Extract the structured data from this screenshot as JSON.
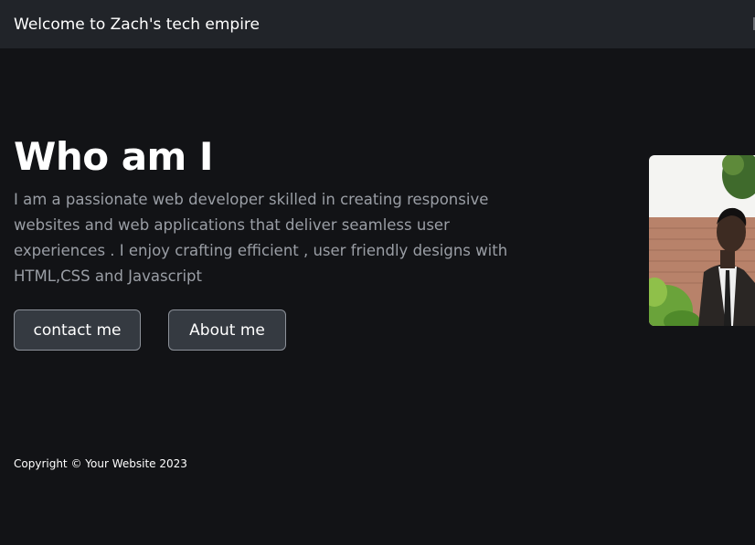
{
  "navbar": {
    "brand": "Welcome to Zach's tech empire"
  },
  "hero": {
    "title": "Who am I",
    "description": "I am a passionate web developer skilled in creating responsive websites and web applications that deliver seamless user experiences . I enjoy crafting efficient , user friendly designs with HTML,CSS and Javascript",
    "buttons": {
      "contact": "contact me",
      "about": "About me"
    },
    "photo_icon": "profile-photo"
  },
  "footer": {
    "copyright": "Copyright © Your Website 2023"
  },
  "colors": {
    "background": "#121316",
    "navbar": "#212429",
    "button_bg": "#353a41",
    "button_border": "#8c9199",
    "muted_text": "#9a9ea5"
  }
}
